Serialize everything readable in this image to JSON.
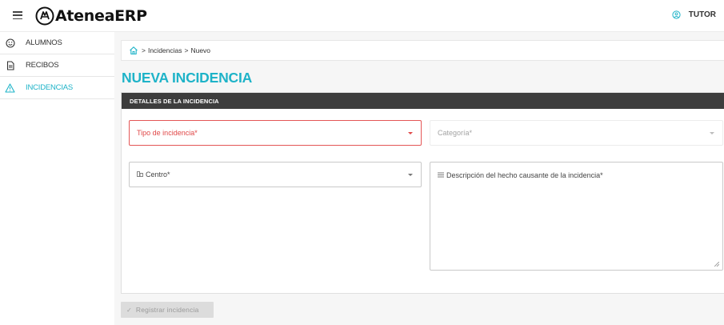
{
  "header": {
    "app_name": "AteneaERP",
    "user_label": "TUTOR",
    "icons": {
      "menu": "hamburger-icon",
      "logo": "atenea-logo",
      "user": "user-circle-icon"
    }
  },
  "sidebar": {
    "items": [
      {
        "label": "ALUMNOS",
        "icon": "smiley-face-icon",
        "active": false
      },
      {
        "label": "RECIBOS",
        "icon": "document-icon",
        "active": false
      },
      {
        "label": "INCIDENCIAS",
        "icon": "warning-triangle-icon",
        "active": true
      }
    ]
  },
  "breadcrumb": {
    "separator": ">",
    "items": [
      "Incidencias",
      "Nuevo"
    ],
    "icon": "home-icon"
  },
  "page": {
    "title": "NUEVA INCIDENCIA"
  },
  "form": {
    "section_title": "DETALLES DE LA INCIDENCIA",
    "tipo_label": "Tipo de incidencia*",
    "categoria_label": "Categoría*",
    "centro_label": "Centro*",
    "descripcion_label": "Descripción del hecho causante de la incidencia*",
    "submit_label": "Registrar incidencia"
  },
  "colors": {
    "accent": "#1eb3c8",
    "header_bar": "#3d3d3d",
    "error": "#e04848",
    "disabled_button": "#dcdcdc"
  }
}
